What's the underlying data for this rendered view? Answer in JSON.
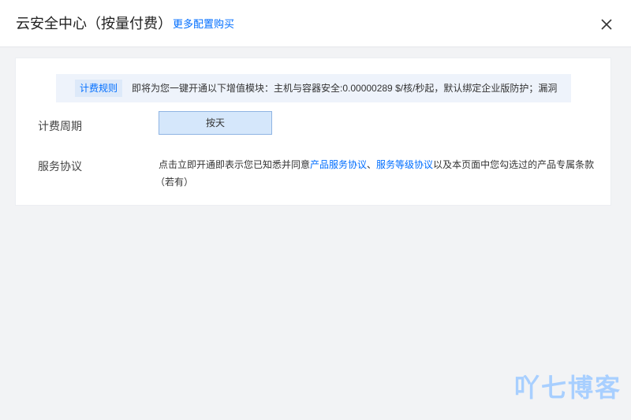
{
  "header": {
    "title": "云安全中心（按量付费）",
    "more_link": "更多配置购买"
  },
  "notice": {
    "tag": "计费规则",
    "text": "即将为您一键开通以下增值模块：主机与容器安全:0.00000289 $/核/秒起，默认绑定企业版防护；漏洞..."
  },
  "billing_cycle": {
    "label": "计费周期",
    "option": "按天"
  },
  "agreement": {
    "label": "服务协议",
    "prefix": "点击立即开通即表示您已知悉并同意",
    "link1": "产品服务协议",
    "sep": "、",
    "link2": "服务等级协议",
    "suffix": "以及本页面中您勾选过的产品专属条款",
    "line2": "（若有）"
  },
  "watermark": "吖七博客",
  "colors": {
    "accent": "#006eff",
    "background": "#f2f3f5",
    "selected_option": "#d5e7fb"
  }
}
